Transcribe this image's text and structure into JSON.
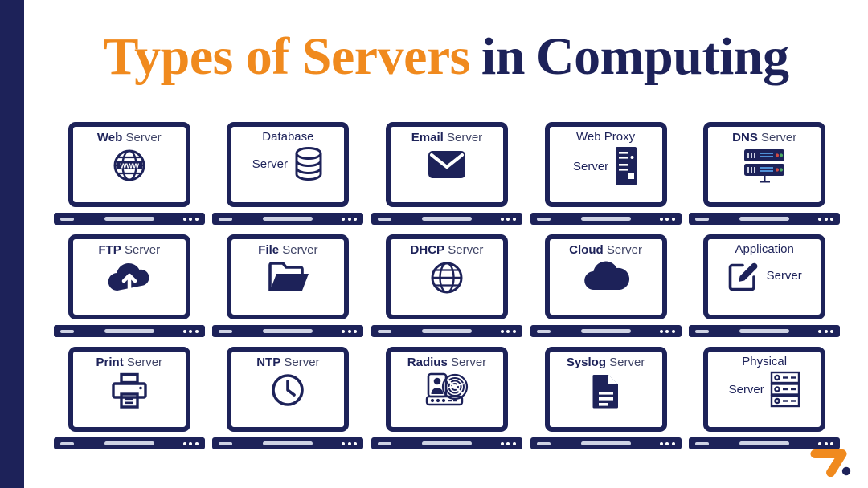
{
  "accent_bar_color": "#1d2259",
  "colors": {
    "navy": "#1d2259",
    "orange": "#f08a1e",
    "grey_text": "#3f4466",
    "background": "#ffffff"
  },
  "title": {
    "part1": "Types of Servers",
    "part2": "in",
    "part3": "Computing",
    "part1_color": "#f08a1e",
    "part2_color": "#1d2259",
    "part3_color": "#1d2259"
  },
  "cards": [
    {
      "bold": "Web",
      "regular": "Server",
      "layout": "inline",
      "icon": "globe-www-icon"
    },
    {
      "bold": "Database",
      "regular": "Server",
      "layout": "stacked-side",
      "icon": "database-cylinder-icon"
    },
    {
      "bold": "Email",
      "regular": "Server",
      "layout": "inline",
      "icon": "envelope-icon"
    },
    {
      "bold": "Web Proxy",
      "regular": "Server",
      "layout": "stacked-side",
      "icon": "server-tower-icon"
    },
    {
      "bold": "DNS",
      "regular": "Server",
      "layout": "inline",
      "icon": "rack-units-icon"
    },
    {
      "bold": "FTP",
      "regular": "Server",
      "layout": "inline",
      "icon": "cloud-upload-icon"
    },
    {
      "bold": "File",
      "regular": "Server",
      "layout": "inline",
      "icon": "folder-open-icon"
    },
    {
      "bold": "DHCP",
      "regular": "Server",
      "layout": "inline",
      "icon": "globe-icon"
    },
    {
      "bold": "Cloud",
      "regular": "Server",
      "layout": "inline",
      "icon": "cloud-icon"
    },
    {
      "bold": "Application",
      "regular": "Server",
      "layout": "stacked-side-left",
      "icon": "edit-square-icon"
    },
    {
      "bold": "Print",
      "regular": "Server",
      "layout": "inline",
      "icon": "printer-icon"
    },
    {
      "bold": "NTP",
      "regular": "Server",
      "layout": "inline",
      "icon": "clock-icon"
    },
    {
      "bold": "Radius",
      "regular": "Server",
      "layout": "inline",
      "icon": "id-fingerprint-icon"
    },
    {
      "bold": "Syslog",
      "regular": "Server",
      "layout": "inline",
      "icon": "document-icon"
    },
    {
      "bold": "Physical",
      "regular": "Server",
      "layout": "stacked-side",
      "icon": "server-rack-icon"
    }
  ],
  "logo": {
    "name": "seven-dot-logo",
    "mark_color": "#f08a1e",
    "dot_color": "#1d2259"
  }
}
